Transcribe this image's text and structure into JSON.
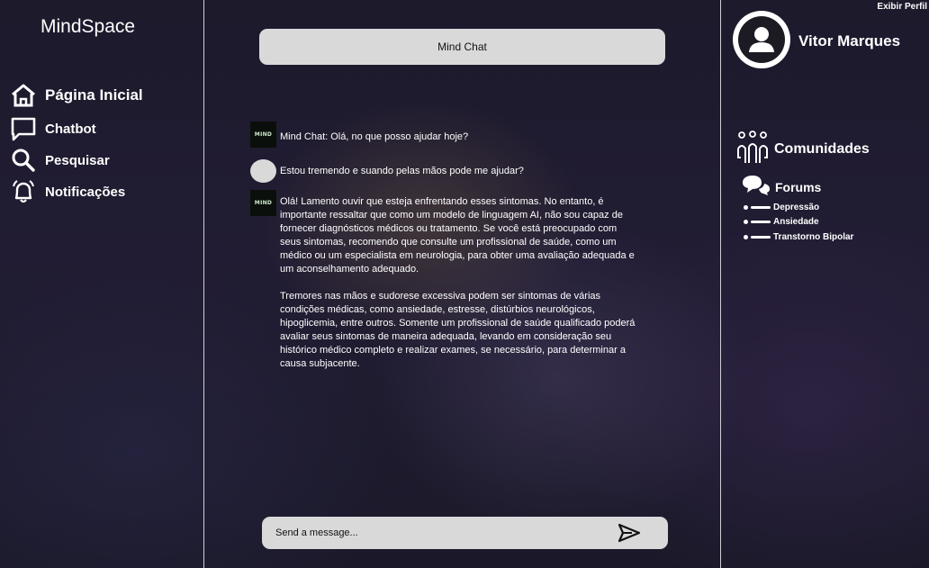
{
  "sidebar": {
    "brand": "MindSpace",
    "items": [
      {
        "label": "Página Inicial",
        "icon": "home-icon"
      },
      {
        "label": "Chatbot",
        "icon": "chat-bubble-icon"
      },
      {
        "label": "Pesquisar",
        "icon": "search-icon"
      },
      {
        "label": "Notificações",
        "icon": "bell-icon"
      }
    ]
  },
  "chat": {
    "title": "Mind Chat",
    "bot_avatar_text": "MIND",
    "messages": [
      {
        "role": "bot",
        "text": "Mind Chat: Olá, no que posso ajudar hoje?"
      },
      {
        "role": "user",
        "text": "Estou tremendo e suando pelas mãos pode me ajudar?"
      },
      {
        "role": "bot",
        "paragraphs": [
          "Olá! Lamento ouvir que esteja enfrentando esses sintomas. No entanto, é importante ressaltar que como um modelo de linguagem AI, não sou capaz de fornecer diagnósticos médicos ou tratamento. Se você está preocupado com seus sintomas, recomendo que consulte um profissional de saúde, como um médico ou um especialista em neurologia, para obter uma avaliação adequada e um aconselhamento adequado.",
          "Tremores nas mãos e sudorese excessiva podem ser sintomas de várias condições médicas, como ansiedade, estresse, distúrbios neurológicos, hipoglicemia, entre outros. Somente um profissional de saúde qualificado poderá avaliar seus sintomas de maneira adequada, levando em consideração seu histórico médico completo e realizar exames, se necessário, para determinar a causa subjacente."
        ]
      }
    ],
    "input_placeholder": "Send a message...",
    "send_icon": "send-icon"
  },
  "profile": {
    "link": "Exibir Perfil",
    "name": "Vitor Marques",
    "avatar_icon": "user-avatar-icon"
  },
  "community": {
    "title": "Comunidades",
    "icon": "community-icon",
    "forums_title": "Forums",
    "forums_icon": "forum-bubbles-icon",
    "forums": [
      "Depressão",
      "Ansiedade",
      "Transtorno Bipolar"
    ]
  }
}
